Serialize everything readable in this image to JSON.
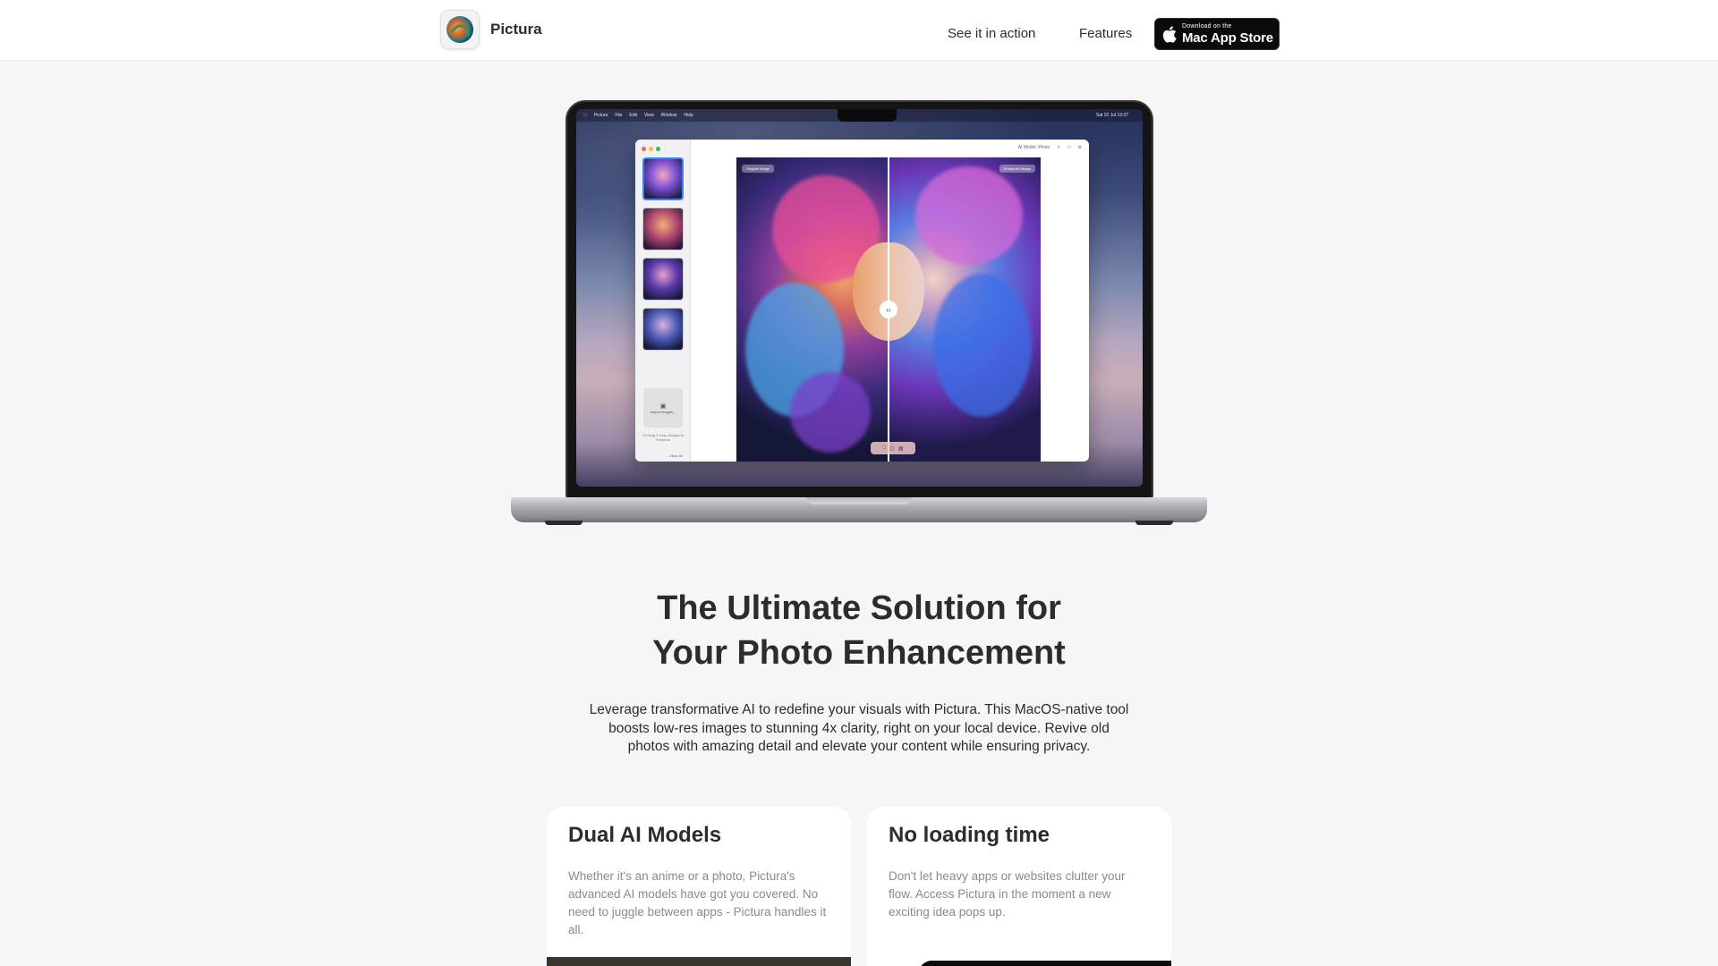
{
  "header": {
    "brand_name": "Pictura",
    "logo_icon": "pictura-logo-icon",
    "nav": [
      {
        "label": "See it in action"
      },
      {
        "label": "Features"
      }
    ],
    "app_store": {
      "small_label": "Download on the",
      "big_label": "Mac App Store",
      "icon": "apple-icon"
    }
  },
  "laptop_screen": {
    "menubar": {
      "items": [
        "Pictura",
        "File",
        "Edit",
        "View",
        "Window",
        "Help"
      ],
      "clock": "Sat 22 Jul 13:37"
    },
    "app_window": {
      "toolbar_label": "AI Model: Photo",
      "before_tag": "Original Image",
      "after_tag": "Enhanced Image",
      "import_label": "Import Images...",
      "drag_note": "Or Drag & Drop Images to Enhance",
      "clear_label": "Clear All"
    }
  },
  "hero": {
    "title_line1": "The Ultimate Solution for",
    "title_line2": "Your Photo Enhancement",
    "description": "Leverage transformative AI to redefine your visuals with Pictura. This MacOS-native tool boosts low-res images to stunning 4x clarity, right on your local device. Revive old photos with amazing detail and elevate your content while ensuring privacy."
  },
  "features": [
    {
      "title": "Dual AI Models",
      "text": "Whether it's an anime or a photo, Pictura's advanced AI models have got you covered. No need to juggle between apps - Pictura handles it all."
    },
    {
      "title": "No loading time",
      "text": "Don't let heavy apps or websites clutter your flow. Access Pictura in the moment a new exciting idea pops up."
    }
  ],
  "colors": {
    "page_bg": "#f6f6f6",
    "header_bg": "#ffffff",
    "text": "#2c2c2c",
    "muted_text": "#8a8a8a",
    "store_button": "#0a0a0a"
  }
}
